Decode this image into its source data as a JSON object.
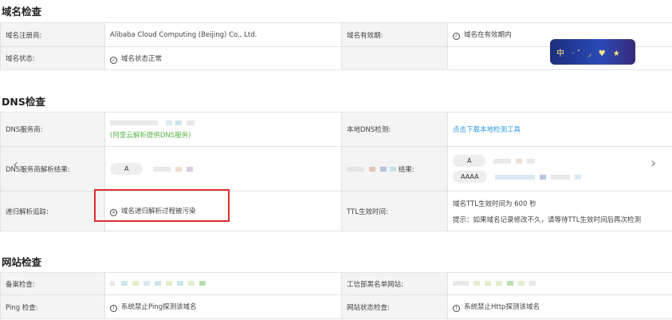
{
  "sections": {
    "domain": "域名检查",
    "dns": "DNS检查",
    "website": "网站检查"
  },
  "domain_check": {
    "registrar_label": "域名注册商:",
    "registrar_value": "Alibaba Cloud Computing (Beijing) Co., Ltd.",
    "validity_label": "域名有效期:",
    "validity_value": "域名在有效期内",
    "status_label": "域名状态:",
    "status_value": "域名状态正常"
  },
  "dns_check": {
    "provider_label": "DNS服务商:",
    "provider_note": "(阿里云解析提供DNS服务)",
    "local_label": "本地DNS检测:",
    "local_link": "点击下载本地检测工具",
    "resolve_label": "DNS服务商解析结果:",
    "resolve_type": "A",
    "local_result_suffix": "结果:",
    "local_type_a": "A",
    "local_type_aaaa": "AAAA",
    "recursive_label": "递归解析追踪:",
    "recursive_value": "域名递归解析过程被污染",
    "ttl_label": "TTL生效时间:",
    "ttl_value": "域名TTL生效时间为 600 秒",
    "ttl_tip": "提示：如果域名记录修改不久，请等待TTL生效时间后再次检测"
  },
  "website_check": {
    "icp_label": "备案检查:",
    "blacklist_label": "工信部黑名单网站:",
    "ping_label": "Ping 检查:",
    "ping_value": "系统禁止Ping探测该域名",
    "http_label": "网站状态检查:",
    "http_value": "系统禁止Http探测该域名"
  },
  "promo_banner": {
    "text": "中 ·ˇ ◞ ♥ ★"
  },
  "icons": {
    "ok": "check-circle-icon",
    "error": "x-circle-icon",
    "warn": "info-circle-icon",
    "prev": "chevron-left-icon",
    "next": "chevron-right-icon"
  },
  "colors": {
    "ok": "#59b547",
    "error": "#e84d4d",
    "warn": "#f0a33a",
    "link": "#2d9adf",
    "highlight": "#e02d2d"
  }
}
